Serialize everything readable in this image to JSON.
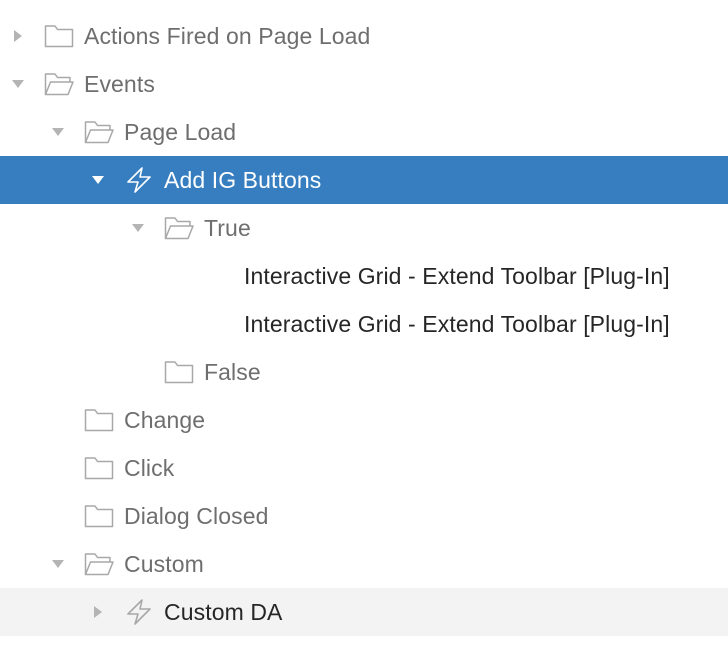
{
  "tree": {
    "actions_fired": {
      "label": "Actions Fired on Page Load",
      "icon": "folder-icon",
      "state": "collapsed"
    },
    "events": {
      "label": "Events",
      "icon": "folder-open-icon",
      "state": "expanded"
    },
    "page_load": {
      "label": "Page Load",
      "icon": "folder-open-icon",
      "state": "expanded"
    },
    "add_ig_buttons": {
      "label": "Add IG Buttons",
      "icon": "lightning-icon",
      "state": "expanded",
      "selected": true
    },
    "true_branch": {
      "label": "True",
      "icon": "folder-open-icon",
      "state": "expanded"
    },
    "action_1": {
      "label": "Interactive Grid - Extend Toolbar [Plug-In]"
    },
    "action_2": {
      "label": "Interactive Grid - Extend Toolbar [Plug-In]"
    },
    "false_branch": {
      "label": "False",
      "icon": "folder-icon"
    },
    "change": {
      "label": "Change",
      "icon": "folder-icon"
    },
    "click": {
      "label": "Click",
      "icon": "folder-icon"
    },
    "dialog_closed": {
      "label": "Dialog Closed",
      "icon": "folder-icon"
    },
    "custom": {
      "label": "Custom",
      "icon": "folder-open-icon",
      "state": "expanded"
    },
    "custom_da": {
      "label": "Custom DA",
      "icon": "lightning-icon",
      "state": "collapsed",
      "hovered": true
    }
  },
  "colors": {
    "selection": "#367ebf",
    "hover": "#f3f3f3",
    "icon_gray": "#a8a8a8",
    "text_gray": "#6e6e6e",
    "text_dark": "#262626"
  }
}
